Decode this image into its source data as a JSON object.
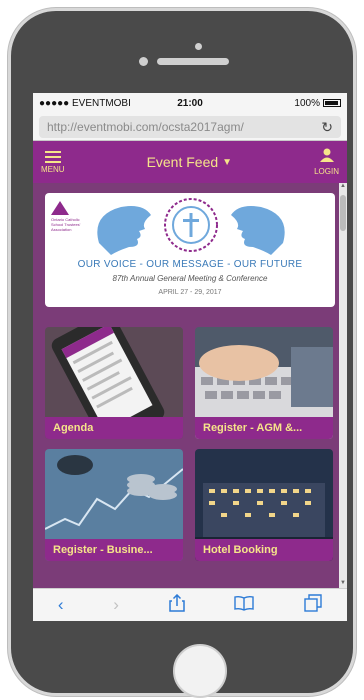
{
  "status": {
    "carrier": "●●●●● EVENTMOBI",
    "time": "21:00",
    "battery": "100%"
  },
  "browser": {
    "url": "http://eventmobi.com/ocsta2017agm/"
  },
  "appbar": {
    "menu_label": "MENU",
    "title": "Event Feed",
    "login_label": "LOGIN"
  },
  "banner": {
    "slogan": "OUR VOICE - OUR MESSAGE - OUR FUTURE",
    "subtitle": "87th Annual General Meeting & Conference",
    "dates": "APRIL 27 - 29, 2017",
    "logo_text": "Ontario Catholic School Trustees' Association"
  },
  "tiles": [
    {
      "label": "Agenda"
    },
    {
      "label": "Register - AGM &..."
    },
    {
      "label": "Register - Busine..."
    },
    {
      "label": "Hotel Booking"
    }
  ],
  "colors": {
    "brand_purple": "#8e2a8c",
    "accent_yellow": "#f6e48a",
    "ios_blue": "#2d7bd6"
  }
}
